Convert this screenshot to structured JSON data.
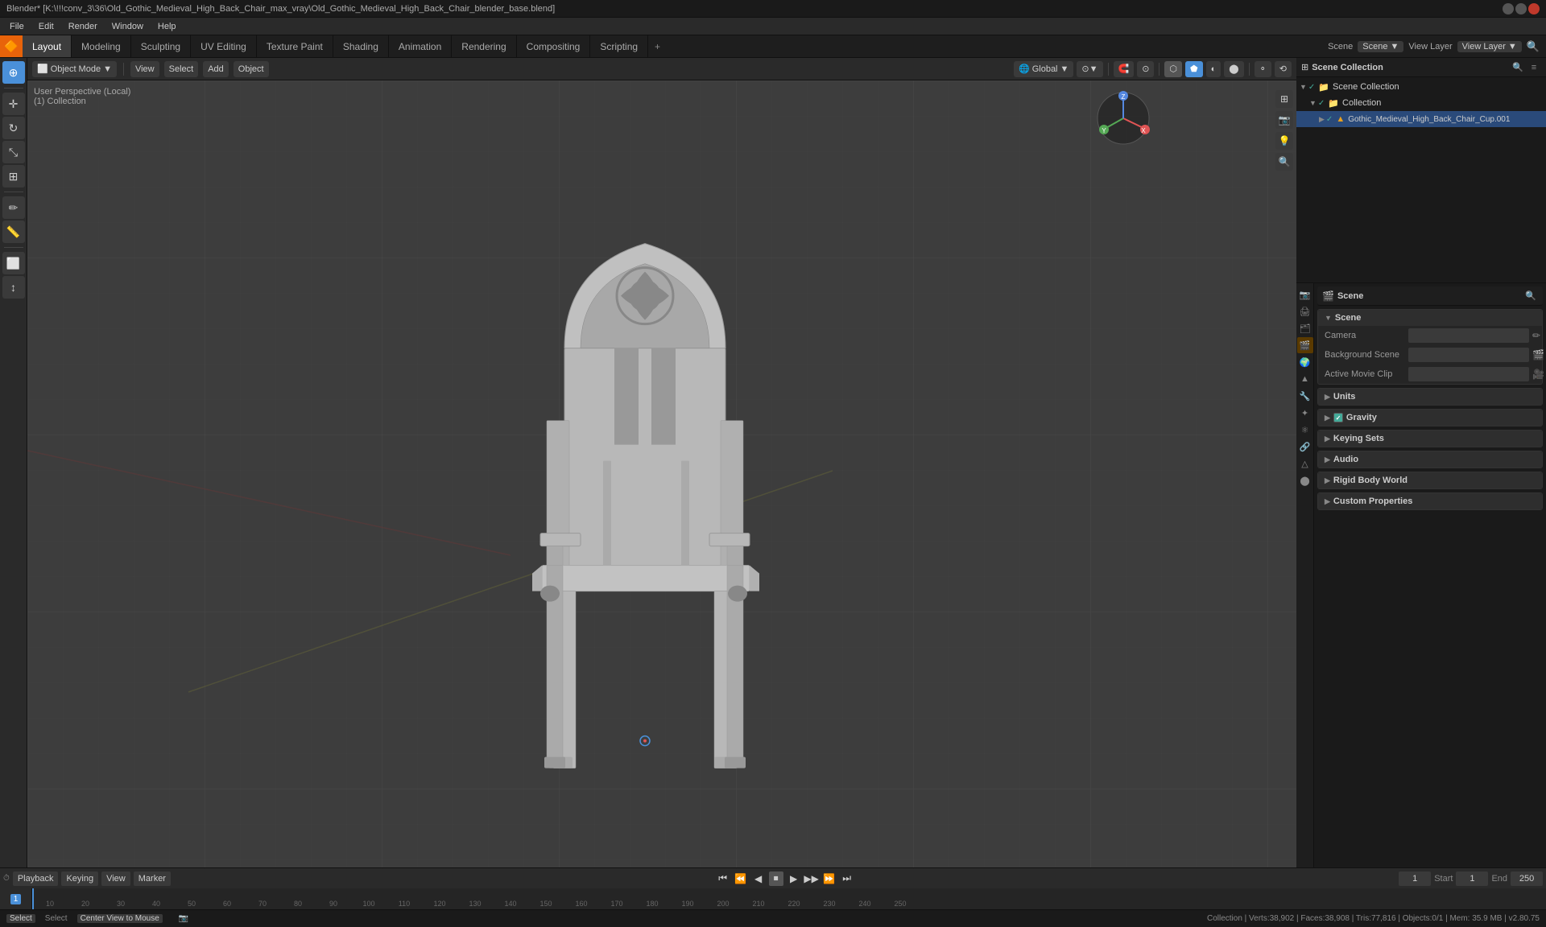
{
  "titleBar": {
    "title": "Blender* [K:\\!!!conv_3\\36\\Old_Gothic_Medieval_High_Back_Chair_max_vray\\Old_Gothic_Medieval_High_Back_Chair_blender_base.blend]",
    "controls": [
      "minimize",
      "maximize",
      "close"
    ]
  },
  "menuBar": {
    "items": [
      "File",
      "Edit",
      "Render",
      "Window",
      "Help"
    ]
  },
  "workspaceTabs": {
    "active": "Layout",
    "tabs": [
      "Layout",
      "Modeling",
      "Sculpting",
      "UV Editing",
      "Texture Paint",
      "Shading",
      "Animation",
      "Rendering",
      "Compositing",
      "Scripting"
    ],
    "addLabel": "+"
  },
  "viewport": {
    "modeLabel": "Object Mode",
    "viewLabel": "View",
    "selectLabel": "Select",
    "addLabel": "Add",
    "objectLabel": "Object",
    "globalLabel": "Global",
    "overlayInfo": {
      "line1": "User Perspective (Local)",
      "line2": "(1) Collection"
    },
    "viewModeIcons": [
      "solid",
      "wireframe",
      "rendered",
      "material"
    ]
  },
  "outliner": {
    "title": "Scene Collection",
    "items": [
      {
        "level": 0,
        "name": "Scene Collection",
        "icon": "📁",
        "checked": true,
        "expanded": true
      },
      {
        "level": 1,
        "name": "Collection",
        "icon": "📁",
        "checked": true,
        "expanded": true
      },
      {
        "level": 2,
        "name": "Gothic_Medieval_High_Back_Chair_Cup.001",
        "icon": "▲",
        "checked": true,
        "expanded": false
      }
    ]
  },
  "propertiesPanel": {
    "title": "Scene",
    "activeIcon": "scene",
    "sections": [
      {
        "name": "Scene",
        "expanded": true,
        "rows": [
          {
            "label": "Camera",
            "value": "",
            "hasIcon": true
          },
          {
            "label": "Background Scene",
            "value": "",
            "hasIcon": true
          },
          {
            "label": "Active Movie Clip",
            "value": "",
            "hasIcon": true
          }
        ]
      },
      {
        "name": "Units",
        "expanded": false,
        "rows": []
      },
      {
        "name": "Gravity",
        "expanded": false,
        "checkbox": true,
        "checked": true,
        "rows": []
      },
      {
        "name": "Keying Sets",
        "expanded": false,
        "rows": []
      },
      {
        "name": "Audio",
        "expanded": false,
        "rows": []
      },
      {
        "name": "Rigid Body World",
        "expanded": false,
        "rows": []
      },
      {
        "name": "Custom Properties",
        "expanded": false,
        "rows": []
      }
    ]
  },
  "timeline": {
    "playback": "Playback",
    "keying": "Keying",
    "view": "View",
    "marker": "Marker",
    "currentFrame": "1",
    "startFrame": "1",
    "endFrame": "250",
    "frameNumbers": [
      "1",
      "10",
      "20",
      "30",
      "40",
      "50",
      "60",
      "70",
      "80",
      "90",
      "100",
      "110",
      "120",
      "130",
      "140",
      "150",
      "160",
      "170",
      "180",
      "190",
      "200",
      "210",
      "220",
      "230",
      "240",
      "250"
    ]
  },
  "statusBar": {
    "left": [
      {
        "key": "Select",
        "desc": "Select"
      },
      {
        "key": "Center View to Mouse",
        "desc": ""
      }
    ],
    "right": "Collection | Verts:38,902 | Faces:38,908 | Tris:77,816 | Objects:0/1 | Mem: 35.9 MB | v2.80.75"
  }
}
